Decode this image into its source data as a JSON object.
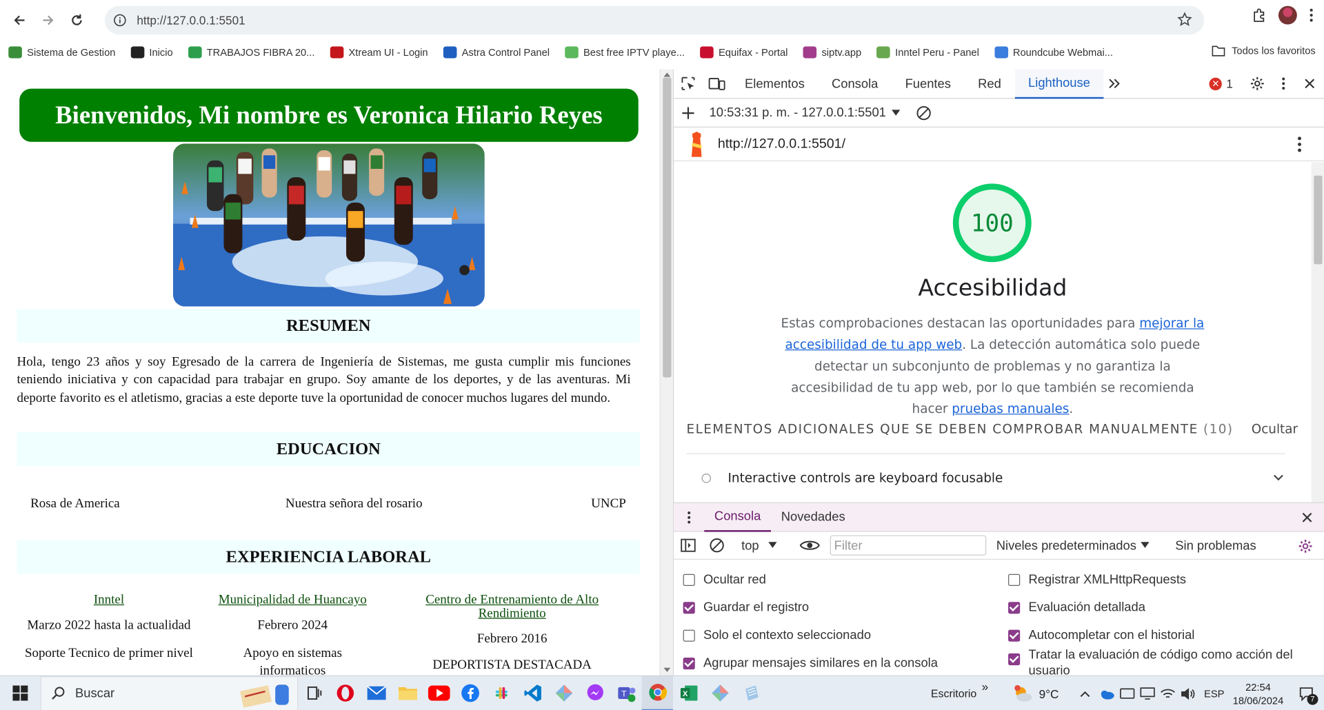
{
  "browser": {
    "url": "http://127.0.0.1:5501",
    "bookmarks": [
      {
        "label": "Sistema de Gestion",
        "color": "#3a8e3a"
      },
      {
        "label": "Inicio",
        "color": "#222222"
      },
      {
        "label": "TRABAJOS FIBRA 20...",
        "color": "#2e9e4d"
      },
      {
        "label": "Xtream UI - Login",
        "color": "#c4161c"
      },
      {
        "label": "Astra Control Panel",
        "color": "#1f5fbf"
      },
      {
        "label": "Best free IPTV playe...",
        "color": "#5cb85c"
      },
      {
        "label": "Equifax - Portal",
        "color": "#c8102e"
      },
      {
        "label": "siptv.app",
        "color": "#a23c8c"
      },
      {
        "label": "Inntel Peru - Panel",
        "color": "#6aa84f"
      },
      {
        "label": "Roundcube Webmai...",
        "color": "#3b7ddd"
      }
    ],
    "all_bookmarks": "Todos los favoritos"
  },
  "page": {
    "hero_title": "Bienvenidos, Mi nombre es Veronica Hilario Reyes",
    "resumen_title": "RESUMEN",
    "resumen_text": "Hola, tengo 23 años y soy Egresado de la carrera de Ingeniería de Sistemas, me gusta cumplir mis funciones teniendo iniciativa y con capacidad para trabajar en grupo. Soy amante de los deportes, y de las aventuras. Mi deporte favorito es el atletismo, gracias a este deporte tuve la oportunidad de conocer muchos lugares del mundo.",
    "educacion_title": "EDUCACION",
    "educacion": [
      "Rosa de America",
      "Nuestra señora del rosario",
      "UNCP"
    ],
    "experiencia_title": "EXPERIENCIA LABORAL",
    "jobs": [
      {
        "company": "Inntel",
        "date": "Marzo 2022 hasta la actualidad",
        "role": "Soporte Tecnico de primer nivel"
      },
      {
        "company": "Municipalidad de Huancayo",
        "date": "Febrero 2024",
        "role": "Apoyo en sistemas informaticos"
      },
      {
        "company": "Centro de Entrenamiento de Alto Rendimiento",
        "date": "Febrero 2016",
        "role": "DEPORTISTA DESTACADA"
      }
    ]
  },
  "devtools": {
    "tabs": [
      "Elementos",
      "Consola",
      "Fuentes",
      "Red",
      "Lighthouse"
    ],
    "active_tab": "Lighthouse",
    "error_count": "1",
    "report_select": "10:53:31 p. m. - 127.0.0.1:5501",
    "report_url": "http://127.0.0.1:5501/",
    "score": "100",
    "category": "Accesibilidad",
    "desc_before": "Estas comprobaciones destacan las oportunidades para ",
    "desc_link1": "mejorar la accesibilidad de tu app web",
    "desc_middle": ". La detección automática solo puede detectar un subconjunto de problemas y no garantiza la accesibilidad de tu app web, por lo que también se recomienda hacer ",
    "desc_link2": "pruebas manuales",
    "desc_after": ".",
    "manual_heading": "ELEMENTOS ADICIONALES QUE SE DEBEN COMPROBAR MANUALMENTE",
    "manual_count": "(10)",
    "hide_label": "Ocultar",
    "audit_item": "Interactive controls are keyboard focusable",
    "drawer_tabs": [
      "Consola",
      "Novedades"
    ],
    "context": "top",
    "filter_placeholder": "Filter",
    "levels": "Niveles predeterminados",
    "issues": "Sin problemas",
    "options_left": [
      {
        "label": "Ocultar red",
        "checked": false
      },
      {
        "label": "Guardar el registro",
        "checked": true
      },
      {
        "label": "Solo el contexto seleccionado",
        "checked": false
      },
      {
        "label": "Agrupar mensajes similares en la consola",
        "checked": true
      }
    ],
    "options_right": [
      {
        "label": "Registrar XMLHttpRequests",
        "checked": false
      },
      {
        "label": "Evaluación detallada",
        "checked": true
      },
      {
        "label": "Autocompletar con el historial",
        "checked": true
      },
      {
        "label": "Tratar la evaluación de código como acción del usuario",
        "checked": true
      }
    ]
  },
  "taskbar": {
    "search": "Buscar",
    "desktop": "Escritorio",
    "weather": "9°C",
    "lang": "ESP",
    "time": "22:54",
    "date": "18/06/2024",
    "notifications": "7"
  }
}
